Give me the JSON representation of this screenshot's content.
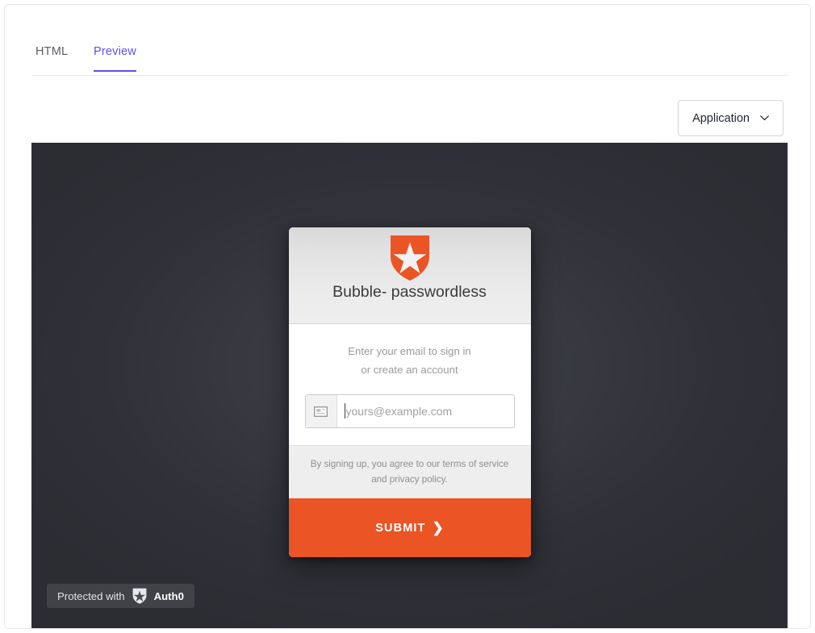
{
  "panel": {
    "tabs": [
      {
        "label": "HTML",
        "active": false
      },
      {
        "label": "Preview",
        "active": true
      }
    ],
    "dropdown": {
      "label": "Application",
      "icon": "chevron-down-icon"
    }
  },
  "preview": {
    "background_color": "#33343b",
    "widget": {
      "logo_icon": "auth0-shield-logo",
      "title": "Bubble- passwordless",
      "instructions_line1": "Enter your email to sign in",
      "instructions_line2": "or create an account",
      "email_field": {
        "icon": "email-card-icon",
        "placeholder": "yours@example.com",
        "value": ""
      },
      "terms_text": "By signing up, you agree to our terms of service and privacy policy.",
      "submit_label": "SUBMIT",
      "submit_arrow": "❯",
      "submit_color": "#eb5424"
    },
    "badge": {
      "text": "Protected with",
      "brand": "Auth0",
      "icon": "auth0-shield-badge-icon"
    }
  }
}
